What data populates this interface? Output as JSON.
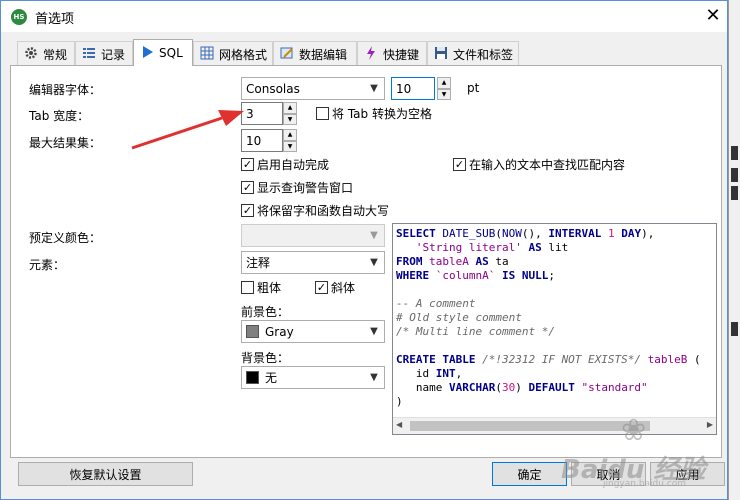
{
  "window": {
    "title": "首选项",
    "app_icon_text": "HS",
    "close_label": "✕"
  },
  "tabs": [
    {
      "label": "常规",
      "icon": "gear-icon"
    },
    {
      "label": "记录",
      "icon": "list-icon"
    },
    {
      "label": "SQL",
      "icon": "play-icon",
      "active": true
    },
    {
      "label": "网格格式",
      "icon": "grid-icon"
    },
    {
      "label": "数据编辑",
      "icon": "edit-icon"
    },
    {
      "label": "快捷键",
      "icon": "lightning-icon"
    },
    {
      "label": "文件和标签",
      "icon": "save-icon"
    }
  ],
  "form": {
    "font_label": "编辑器字体：",
    "font_value": "Consolas",
    "font_size": "10",
    "font_unit": "pt",
    "tab_width_label": "Tab 宽度：",
    "tab_width_value": "3",
    "tab_to_space": {
      "label": "将 Tab 转换为空格",
      "checked": false
    },
    "max_results_label": "最大结果集：",
    "max_results_value": "10",
    "autocomplete": {
      "label": "启用自动完成",
      "checked": true
    },
    "find_match": {
      "label": "在输入的文本中查找匹配内容",
      "checked": true
    },
    "query_warning": {
      "label": "显示查询警告窗口",
      "checked": true
    },
    "auto_upper": {
      "label": "将保留字和函数自动大写",
      "checked": true
    },
    "predefined_color_label": "预定义颜色：",
    "predefined_color_value": "",
    "element_label": "元素：",
    "element_value": "注释",
    "bold": {
      "label": "粗体",
      "checked": false
    },
    "italic": {
      "label": "斜体",
      "checked": true
    },
    "fg_label": "前景色：",
    "fg_value": "Gray",
    "fg_color": "#808080",
    "bg_label": "背景色：",
    "bg_value": "无",
    "bg_color": "#000000"
  },
  "preview": {
    "lines": [
      [
        [
          "kw",
          "SELECT "
        ],
        [
          "fn",
          "DATE_SUB"
        ],
        [
          "p",
          "("
        ],
        [
          "fn",
          "NOW"
        ],
        [
          "p",
          "(), "
        ],
        [
          "kw",
          "INTERVAL "
        ],
        [
          "num",
          "1"
        ],
        [
          "kw",
          " DAY"
        ],
        [
          "p",
          "),"
        ]
      ],
      [
        [
          "p",
          "   "
        ],
        [
          "str",
          "'String literal'"
        ],
        [
          "kw",
          " AS "
        ],
        [
          "p",
          "lit"
        ]
      ],
      [
        [
          "kw",
          "FROM "
        ],
        [
          "id",
          "tableA"
        ],
        [
          "kw",
          " AS "
        ],
        [
          "p",
          "ta"
        ]
      ],
      [
        [
          "kw",
          "WHERE "
        ],
        [
          "id",
          "`columnA`"
        ],
        [
          "kw",
          " IS NULL"
        ],
        [
          "p",
          ";"
        ]
      ],
      [
        [
          "p",
          ""
        ]
      ],
      [
        [
          "cm",
          "-- A comment"
        ]
      ],
      [
        [
          "cm",
          "# Old style comment"
        ]
      ],
      [
        [
          "cm",
          "/* Multi line comment */"
        ]
      ],
      [
        [
          "p",
          ""
        ]
      ],
      [
        [
          "kw",
          "CREATE TABLE "
        ],
        [
          "cm",
          "/*!32312 IF NOT EXISTS*/ "
        ],
        [
          "id",
          "tableB"
        ],
        [
          "p",
          " ("
        ]
      ],
      [
        [
          "p",
          "   id "
        ],
        [
          "kw",
          "INT"
        ],
        [
          "p",
          ","
        ]
      ],
      [
        [
          "p",
          "   name "
        ],
        [
          "kw",
          "VARCHAR"
        ],
        [
          "p",
          "("
        ],
        [
          "num",
          "30"
        ],
        [
          "p",
          ") "
        ],
        [
          "kw",
          "DEFAULT "
        ],
        [
          "str",
          "\"standard\""
        ]
      ],
      [
        [
          "p",
          ")"
        ]
      ]
    ]
  },
  "buttons": {
    "reset": "恢复默认设置",
    "ok": "确定",
    "cancel": "取消",
    "apply": "应用"
  },
  "watermark": {
    "text": "Baidu 经验",
    "sub": "jingyan.baidu.com"
  },
  "colors": {
    "accent": "#0078d7",
    "arrow": "#e03030",
    "border": "#adadad"
  }
}
